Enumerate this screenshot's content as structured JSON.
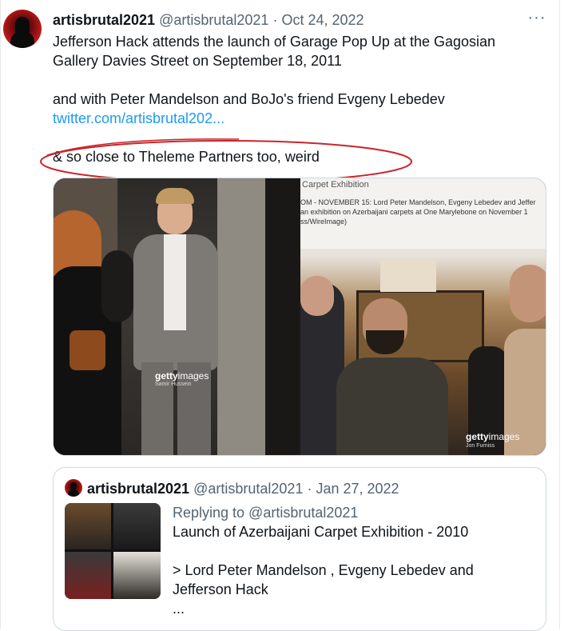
{
  "tweet": {
    "display_name": "artisbrutal2021",
    "handle": "@artisbrutal2021",
    "separator": " · ",
    "date": "Oct 24, 2022",
    "more_label": "···",
    "text_line1": "Jefferson Hack attends the launch of Garage Pop Up at the Gagosian",
    "text_line2": "Gallery Davies Street on September 18, 2011",
    "text_line3": "and with Peter Mandelson and BoJo's friend Evgeny Lebedev",
    "link_text": "twitter.com/artisbrutal202...",
    "text_line4": "& so close to Theleme Partners too, weird",
    "link_color": "#1d9bf0"
  },
  "media": {
    "left": {
      "watermark": "gettyimages",
      "watermark_bold": "getty",
      "watermark_thin": "images",
      "credit": "Samir Hussein"
    },
    "right": {
      "caption_title": "Carpet Exhibition",
      "caption_line1": "OM - NOVEMBER 15: Lord Peter Mandelson, Evgeny Lebedev and Jeffer",
      "caption_line2": "an exhibition on Azerbaijani carpets at One Marylebone on November 1",
      "caption_line3": "ss/WireImage)",
      "watermark_bold": "getty",
      "watermark_thin": "images",
      "credit": "Jon Furniss"
    }
  },
  "quote": {
    "display_name": "artisbrutal2021",
    "handle": "@artisbrutal2021",
    "separator": " · ",
    "date": "Jan 27, 2022",
    "replying_to": "Replying to @artisbrutal2021",
    "line1": "Launch of Azerbaijani Carpet Exhibition - 2010",
    "line2": "> Lord Peter Mandelson , Evgeny Lebedev and",
    "line3": "Jefferson Hack",
    "line4": "..."
  }
}
